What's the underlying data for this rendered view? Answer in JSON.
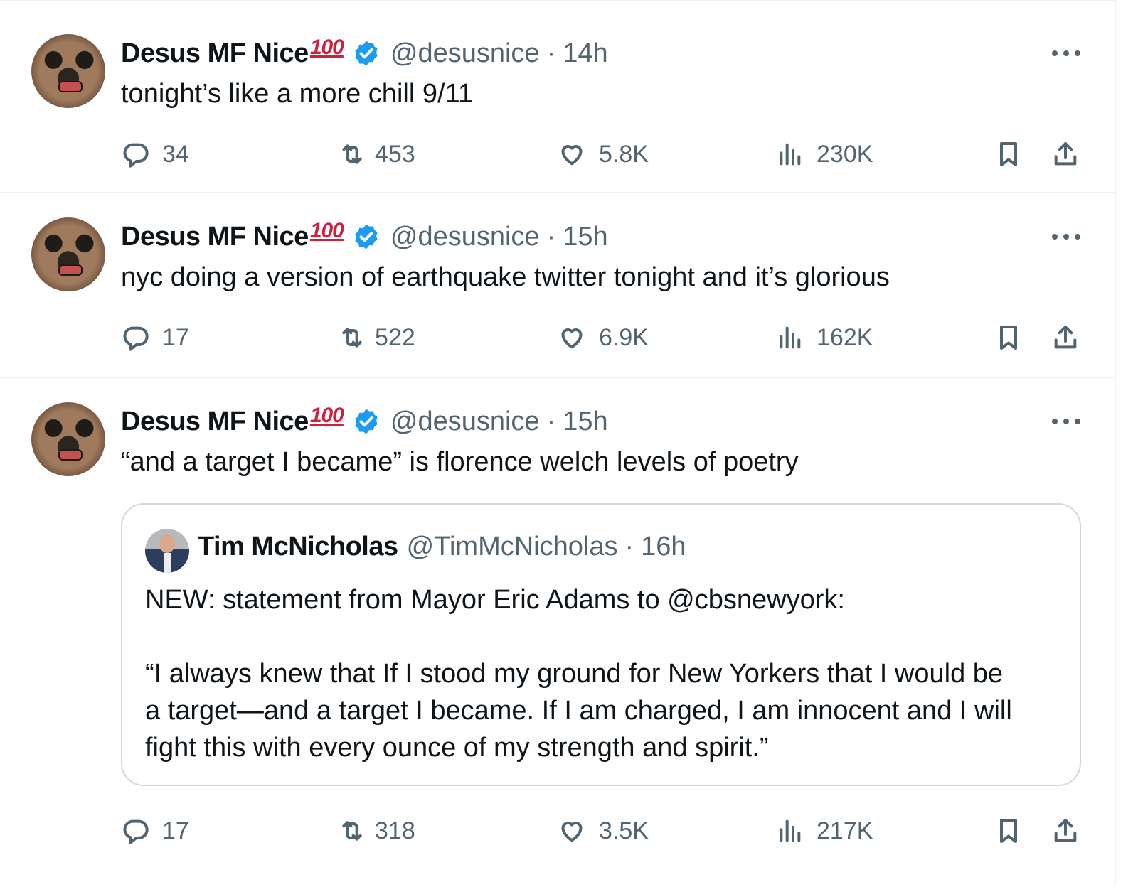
{
  "colors": {
    "text": "#0f1419",
    "muted": "#536471",
    "verified": "#1d9bf0",
    "divider": "#eff3f4",
    "quote_border": "#cfd9de"
  },
  "tweets": [
    {
      "author": "Desus MF Nice",
      "badge": "100",
      "handle": "@desusnice",
      "separator": "·",
      "time": "14h",
      "text": "tonight’s like a more chill 9/11",
      "replies": "34",
      "reposts": "453",
      "likes": "5.8K",
      "views": "230K"
    },
    {
      "author": "Desus MF Nice",
      "badge": "100",
      "handle": "@desusnice",
      "separator": "·",
      "time": "15h",
      "text": "nyc doing a version of earthquake twitter tonight and it’s glorious",
      "replies": "17",
      "reposts": "522",
      "likes": "6.9K",
      "views": "162K"
    },
    {
      "author": "Desus MF Nice",
      "badge": "100",
      "handle": "@desusnice",
      "separator": "·",
      "time": "15h",
      "text": "“and a target I became” is florence welch levels of poetry",
      "replies": "17",
      "reposts": "318",
      "likes": "3.5K",
      "views": "217K",
      "quote": {
        "author": "Tim McNicholas",
        "handle": "@TimMcNicholas",
        "separator": "·",
        "time": "16h",
        "line1": "NEW: statement from Mayor Eric Adams to @cbsnewyork:",
        "line2": "“I always knew that If I stood my ground for New Yorkers that I would be",
        "line3": "a target—and a target I became. If I am charged, I am innocent and I will",
        "line4": "fight this with every ounce of my strength and spirit.”"
      }
    }
  ],
  "icons": [
    "reply-icon",
    "repost-icon",
    "like-icon",
    "views-icon",
    "bookmark-icon",
    "share-icon",
    "verified-badge-icon",
    "more-icon"
  ]
}
